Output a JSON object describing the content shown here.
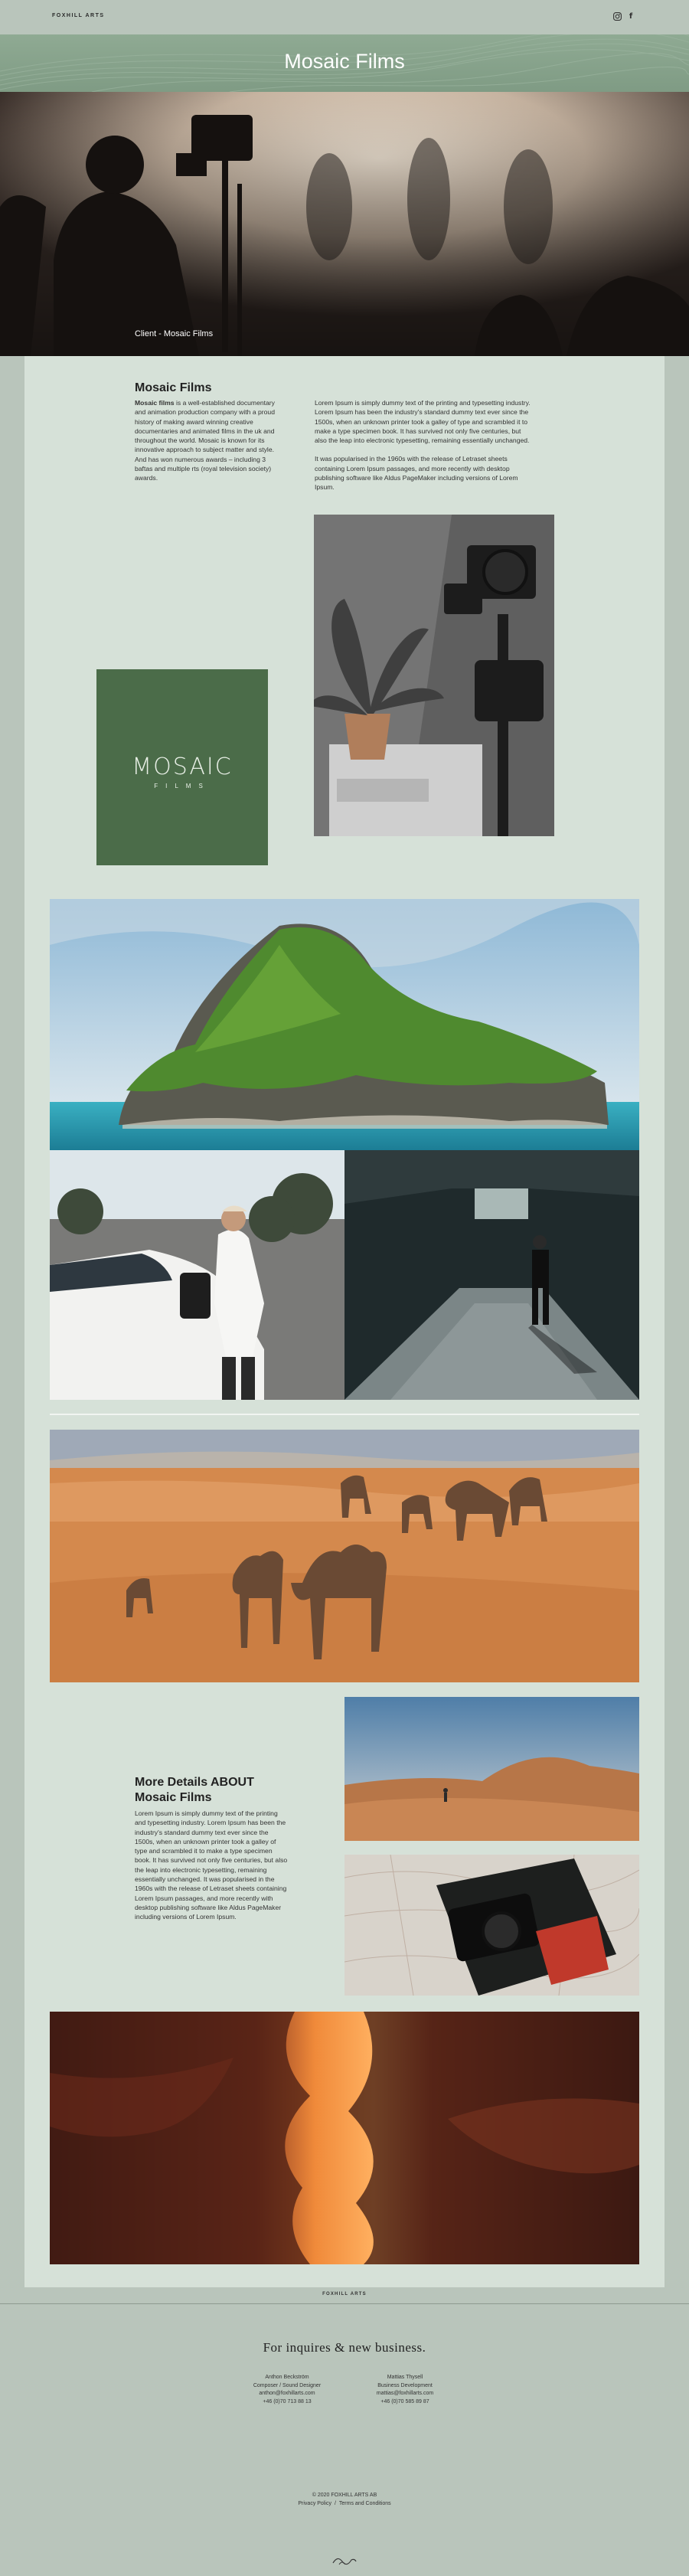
{
  "header": {
    "brand": "FOXHILL ARTS",
    "social": [
      {
        "name": "instagram-icon"
      },
      {
        "name": "facebook-icon",
        "glyph": "f"
      }
    ]
  },
  "title_bar": {
    "title": "Mosaic Films",
    "color": "#8aa78f"
  },
  "hero": {
    "caption": "Client - Mosaic Films"
  },
  "section_intro": {
    "heading": "Mosaic Films",
    "lead_bold": "Mosaic films",
    "lead_rest": " is a well-established documentary and animation production company with a proud history of making award winning creative documentaries and animated films in the uk and throughout the world. Mosaic is known for its innovative approach to subject matter and style. And has won numerous awards – including 3 baftas and multiple rts (royal television society) awards.",
    "right_p1": "Lorem Ipsum is simply dummy text of the printing and typesetting industry. Lorem Ipsum has been the industry's standard dummy text ever since the 1500s, when an unknown printer took a galley of type and scrambled it to make a type specimen book. It has survived not only five centuries, but also the leap into electronic typesetting, remaining essentially unchanged.",
    "right_p2": "It was popularised in the 1960s with the release of Letraset sheets containing Lorem Ipsum passages, and more recently with desktop publishing software like Aldus PageMaker including versions of Lorem Ipsum."
  },
  "logo": {
    "word": "MOSAIC",
    "sub": "FILMS",
    "background": "#4b6c49"
  },
  "section_details": {
    "heading_line1": "More Details ABOUT",
    "heading_line2": "Mosaic Films",
    "body": "Lorem Ipsum is simply dummy text of the printing and typesetting industry. Lorem Ipsum has been the industry's standard dummy text ever since the 1500s, when an unknown printer took a galley of type and scrambled it to make a type specimen book. It has survived not only five centuries, but also the leap into electronic typesetting, remaining essentially unchanged. It was popularised in the 1960s with the release of Letraset sheets containing Lorem Ipsum passages, and more recently with desktop publishing software like Aldus PageMaker including versions of Lorem Ipsum."
  },
  "footer": {
    "brand": "FOXHILL ARTS",
    "inquiry": "For inquires & new business.",
    "contacts": [
      {
        "name": "Anthon Beckström",
        "role": "Composer / Sound Designer",
        "email": "anthon@foxhillarts.com",
        "phone": "+46 (0)70 713 88 13"
      },
      {
        "name": "Mattias Thysell",
        "role": "Business Development",
        "email": "mattias@foxhillarts.com",
        "phone": "+46 (0)70 585 89 87"
      }
    ],
    "copyright": "© 2020 FOXHILL ARTS AB",
    "privacy": "Privacy Policy",
    "separator": "/",
    "terms": "Terms and Conditions"
  }
}
